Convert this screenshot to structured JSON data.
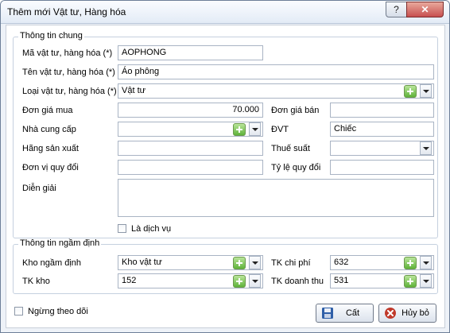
{
  "window": {
    "title": "Thêm mới Vật tư, Hàng hóa",
    "help_label": "?",
    "close_label": "✕"
  },
  "general": {
    "legend": "Thông tin chung",
    "code_label": "Mã vật tư, hàng hóa (*)",
    "code_value": "AOPHONG",
    "name_label": "Tên vật tư, hàng hóa (*)",
    "name_value": "Áo phông",
    "type_label": "Loại vật tư, hàng hóa (*)",
    "type_value": "Vật tư",
    "buy_price_label": "Đơn giá mua",
    "buy_price_value": "70.000",
    "sell_price_label": "Đơn giá bán",
    "sell_price_value": "",
    "supplier_label": "Nhà cung cấp",
    "supplier_value": "",
    "unit_label": "ĐVT",
    "unit_value": "Chiếc",
    "manufacturer_label": "Hãng sản xuất",
    "manufacturer_value": "",
    "tax_label": "Thuế suất",
    "tax_value": "",
    "conv_unit_label": "Đơn vị quy đổi",
    "conv_unit_value": "",
    "conv_rate_label": "Tỷ lệ quy đổi",
    "conv_rate_value": "",
    "desc_label": "Diễn giải",
    "desc_value": "",
    "service_label": "Là dịch vụ",
    "service_checked": false
  },
  "defaults": {
    "legend": "Thông tin ngầm định",
    "warehouse_label": "Kho ngầm định",
    "warehouse_value": "Kho vật tư",
    "expense_acc_label": "TK chi phí",
    "expense_acc_value": "632",
    "stock_acc_label": "TK kho",
    "stock_acc_value": "152",
    "revenue_acc_label": "TK doanh thu",
    "revenue_acc_value": "531"
  },
  "footer": {
    "stop_tracking_label": "Ngừng theo dõi",
    "stop_tracking_checked": false,
    "save_label": "Cất",
    "cancel_label": "Hủy bỏ"
  },
  "colors": {
    "add_green": "#5fb33a",
    "cancel_red": "#c0392b",
    "save_blue": "#2f5fa8"
  }
}
